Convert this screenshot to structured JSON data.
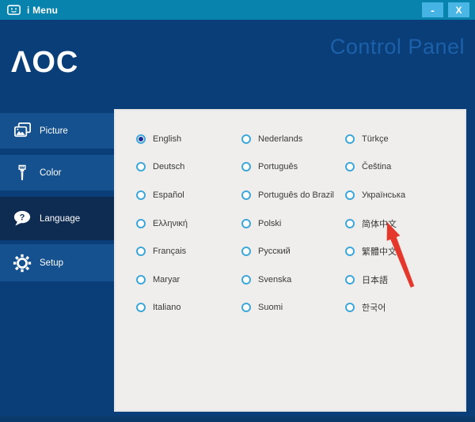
{
  "window": {
    "title": "i Menu",
    "minimize_glyph": "-",
    "close_glyph": "X"
  },
  "header": {
    "logo_text": "ΛOC",
    "title": "Control Panel"
  },
  "sidebar": {
    "items": [
      {
        "label": "Picture",
        "icon": "picture-icon",
        "selected": false
      },
      {
        "label": "Color",
        "icon": "paintbrush-icon",
        "selected": false
      },
      {
        "label": "Language",
        "icon": "question-bubble-icon",
        "selected": true,
        "icon_glyph": "?"
      },
      {
        "label": "Setup",
        "icon": "gear-icon",
        "selected": false
      }
    ]
  },
  "language_panel": {
    "selected": "English",
    "columns": [
      [
        "English",
        "Deutsch",
        "Español",
        "Ελληνική",
        "Français",
        "Maryar",
        "Italiano"
      ],
      [
        "Nederlands",
        "Português",
        "Português do Brazil",
        "Polski",
        "Русский",
        "Svenska",
        "Suomi"
      ],
      [
        "Türkçe",
        "Čeština",
        "Українська",
        "简体中文",
        "繁體中文",
        "日本語",
        "한국어"
      ]
    ],
    "arrow_points_to": "简体中文"
  },
  "colors": {
    "titlebar": "#0783ad",
    "window_background": "#0a3e79",
    "sidebar_item": "#15518e",
    "sidebar_selected": "#0e2b52",
    "panel_background": "#efeeec",
    "radio_ring": "#3ea7d9",
    "radio_dot": "#1f2d96",
    "header_title_text": "#1c60a9",
    "window_button": "#45b3e3",
    "arrow_red": "#e5382c"
  }
}
